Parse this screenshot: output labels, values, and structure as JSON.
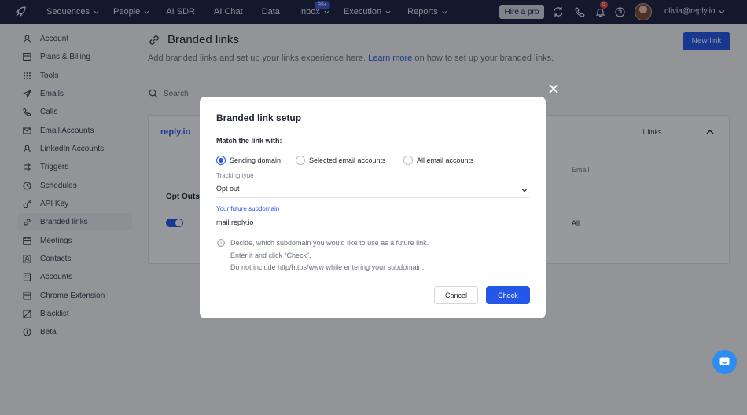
{
  "nav": {
    "items": [
      {
        "label": "Sequences",
        "chevron": true
      },
      {
        "label": "People",
        "chevron": true
      },
      {
        "label": "AI SDR",
        "chevron": false
      },
      {
        "label": "AI Chat",
        "chevron": false
      },
      {
        "label": "Data",
        "chevron": false
      },
      {
        "label": "Inbox",
        "chevron": true,
        "badge": "99+"
      },
      {
        "label": "Execution",
        "chevron": true
      },
      {
        "label": "Reports",
        "chevron": true
      }
    ],
    "hire_label": "Hire a pro",
    "notifications_count": "5",
    "user_email": "olivia@reply.io"
  },
  "sidebar": {
    "items": [
      {
        "label": "Account",
        "icon": "user-icon"
      },
      {
        "label": "Plans & Billing",
        "icon": "billing-icon"
      },
      {
        "label": "Tools",
        "icon": "grid-icon"
      },
      {
        "label": "Emails",
        "icon": "send-icon"
      },
      {
        "label": "Calls",
        "icon": "phone-icon"
      },
      {
        "label": "Email Accounts",
        "icon": "mail-icon"
      },
      {
        "label": "LinkedIn Accounts",
        "icon": "linkedin-icon"
      },
      {
        "label": "Triggers",
        "icon": "trigger-icon"
      },
      {
        "label": "Schedules",
        "icon": "clock-icon"
      },
      {
        "label": "API Key",
        "icon": "key-icon"
      },
      {
        "label": "Branded links",
        "icon": "link-icon",
        "active": true
      },
      {
        "label": "Meetings",
        "icon": "calendar-icon"
      },
      {
        "label": "Contacts",
        "icon": "contacts-icon"
      },
      {
        "label": "Accounts",
        "icon": "building-icon"
      },
      {
        "label": "Chrome Extension",
        "icon": "extension-icon"
      },
      {
        "label": "Blacklist",
        "icon": "block-icon"
      },
      {
        "label": "Beta",
        "icon": "plus-circle-icon"
      }
    ]
  },
  "main": {
    "title": "Branded links",
    "subtitle_pre": "Add branded links and set up your links experience here.",
    "subtitle_link": "Learn more",
    "subtitle_post": "on how to set up your branded links.",
    "new_link_label": "New link",
    "search_placeholder": "Search",
    "card": {
      "domain": "reply.io",
      "links_count": "1 links",
      "col_email": "Email",
      "col_optouts": "Opt Outs",
      "cell_all": "All"
    }
  },
  "modal": {
    "title": "Branded link setup",
    "match_label": "Match the link with:",
    "radios": [
      {
        "label": "Sending domain",
        "checked": true
      },
      {
        "label": "Selected email accounts",
        "checked": false
      },
      {
        "label": "All email accounts",
        "checked": false
      }
    ],
    "tracking_label": "Tracking type",
    "tracking_value": "Opt out",
    "subdomain_label": "Your future subdomain",
    "subdomain_value": "mail.reply.io",
    "hints": [
      "Decide, which subdomain you would like to use as a future link.",
      "Enter it and click “Check”.",
      "Do not include http/https/www while entering your subdomain."
    ],
    "cancel_label": "Cancel",
    "check_label": "Check"
  }
}
